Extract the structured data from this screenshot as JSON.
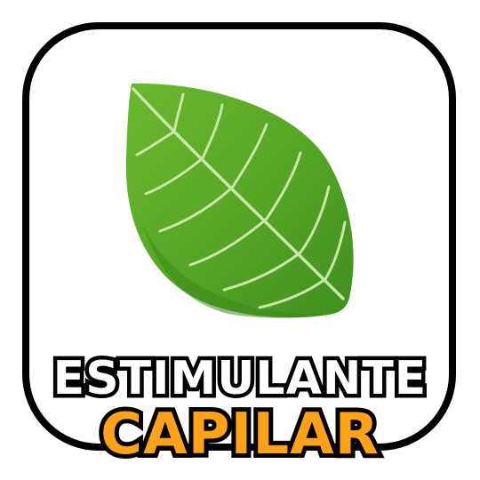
{
  "badge": {
    "line1": "ESTIMULANTE",
    "line2": "CAPILAR",
    "icon": "leaf-icon",
    "colors": {
      "leaf_light": "#6bb82e",
      "leaf_dark": "#3f8f1f",
      "vein": "#c9e6a6",
      "line1_fill": "#ffffff",
      "line2_fill": "#ffa21a",
      "outline": "#000000"
    }
  }
}
